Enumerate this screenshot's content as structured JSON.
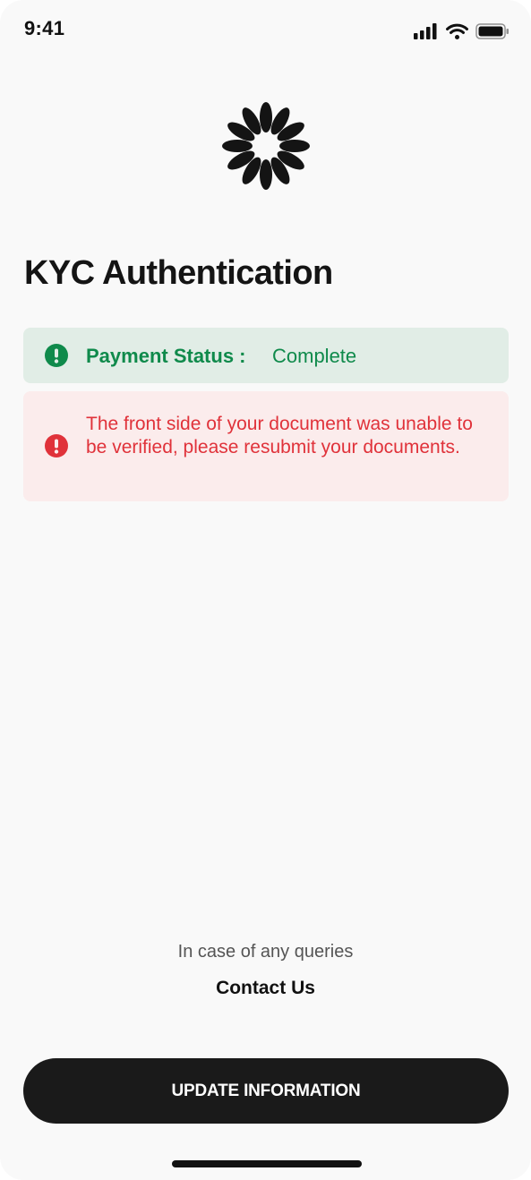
{
  "status_bar": {
    "time": "9:41"
  },
  "page": {
    "title": "KYC Authentication"
  },
  "payment": {
    "label": "Payment Status :",
    "value": "Complete"
  },
  "alert": {
    "message": "The front side of your document was unable to be verified, please resubmit your documents."
  },
  "footer": {
    "query_text": "In case of any queries",
    "contact_label": "Contact Us",
    "button_label": "UPDATE INFORMATION"
  },
  "colors": {
    "success": "#0f8a4b",
    "success_bg": "#e1ede6",
    "error": "#e0323a",
    "error_bg": "#fbecec",
    "button": "#1a1a1a"
  },
  "icons": [
    "signal-icon",
    "wifi-icon",
    "battery-icon",
    "brand-logo-icon",
    "exclamation-icon"
  ]
}
